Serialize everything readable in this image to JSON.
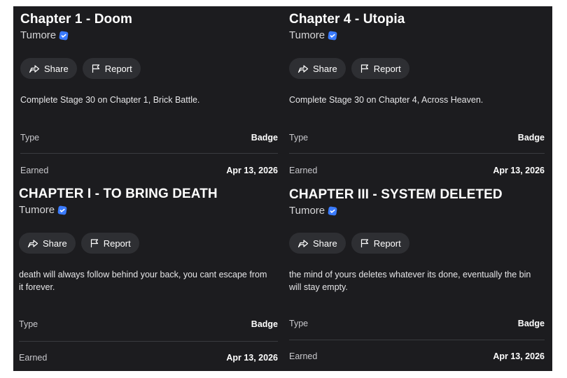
{
  "cards": [
    {
      "title": "Chapter 1 - Doom",
      "creator": "Tumore",
      "share_label": "Share",
      "report_label": "Report",
      "description": "Complete Stage 30 on Chapter 1, Brick Battle.",
      "type_label": "Type",
      "type_value": "Badge",
      "earned_label": "Earned",
      "earned_value": "Apr 13, 2026"
    },
    {
      "title": "Chapter 4 - Utopia",
      "creator": "Tumore",
      "share_label": "Share",
      "report_label": "Report",
      "description": "Complete Stage 30 on Chapter 4, Across Heaven.",
      "type_label": "Type",
      "type_value": "Badge",
      "earned_label": "Earned",
      "earned_value": "Apr 13, 2026"
    },
    {
      "title": "CHAPTER I - TO BRING DEATH",
      "creator": "Tumore",
      "share_label": "Share",
      "report_label": "Report",
      "description": "death will always follow behind your back, you cant escape from it forever.",
      "type_label": "Type",
      "type_value": "Badge",
      "earned_label": "Earned",
      "earned_value": "Apr 13, 2026"
    },
    {
      "title": "CHAPTER III - SYSTEM DELETED",
      "creator": "Tumore",
      "share_label": "Share",
      "report_label": "Report",
      "description": "the mind of yours deletes whatever its done, eventually the bin will stay empty.",
      "type_label": "Type",
      "type_value": "Badge",
      "earned_label": "Earned",
      "earned_value": "Apr 13, 2026"
    }
  ],
  "icons": {
    "verified": "verified-badge-icon",
    "share": "share-arrow-icon",
    "report": "flag-icon"
  },
  "colors": {
    "panel_background": "#1c1c1f",
    "button_background": "#2e2f33",
    "verified_blue": "#3a7bff"
  }
}
